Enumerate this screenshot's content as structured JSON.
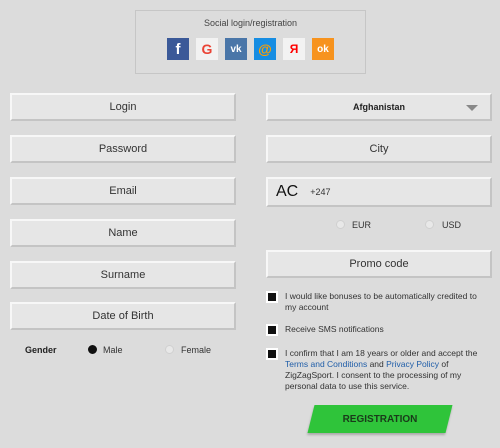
{
  "social": {
    "title": "Social login/registration",
    "icons": [
      {
        "name": "facebook-icon",
        "glyph": "f",
        "bg": "#3b5998",
        "fg": "#ffffff"
      },
      {
        "name": "google-icon",
        "glyph": "G",
        "bg": "#f2f2f2",
        "fg": "#ea4335"
      },
      {
        "name": "vk-icon",
        "glyph": "vk",
        "bg": "#4a76a8",
        "fg": "#ffffff"
      },
      {
        "name": "mailru-icon",
        "glyph": "@",
        "bg": "#168de2",
        "fg": "#ff9e00"
      },
      {
        "name": "yandex-icon",
        "glyph": "Я",
        "bg": "#f2f2f2",
        "fg": "#ff0000"
      },
      {
        "name": "odnoklassniki-icon",
        "glyph": "ok",
        "bg": "#f7931e",
        "fg": "#ffffff"
      }
    ]
  },
  "form": {
    "login": "Login",
    "password": "Password",
    "email": "Email",
    "name": "Name",
    "surname": "Surname",
    "dob": "Date of Birth",
    "gender_label": "Gender",
    "male": "Male",
    "female": "Female",
    "country": "Afghanistan",
    "city": "City",
    "phone_code": "AC",
    "phone_prefix": "+247",
    "currency_eur": "EUR",
    "currency_usd": "USD",
    "promo": "Promo code"
  },
  "checks": {
    "bonuses": "I would like bonuses to be automatically credited to my account",
    "sms": "Receive SMS notifications",
    "confirm_pre": "I confirm that I am 18 years or older and accept the ",
    "terms": "Terms and Conditions",
    "and": " and ",
    "privacy": "Privacy Policy",
    "confirm_post": " of ZigZagSport. I consent to the processing of my personal data to use this service."
  },
  "register_label": "REGISTRATION"
}
